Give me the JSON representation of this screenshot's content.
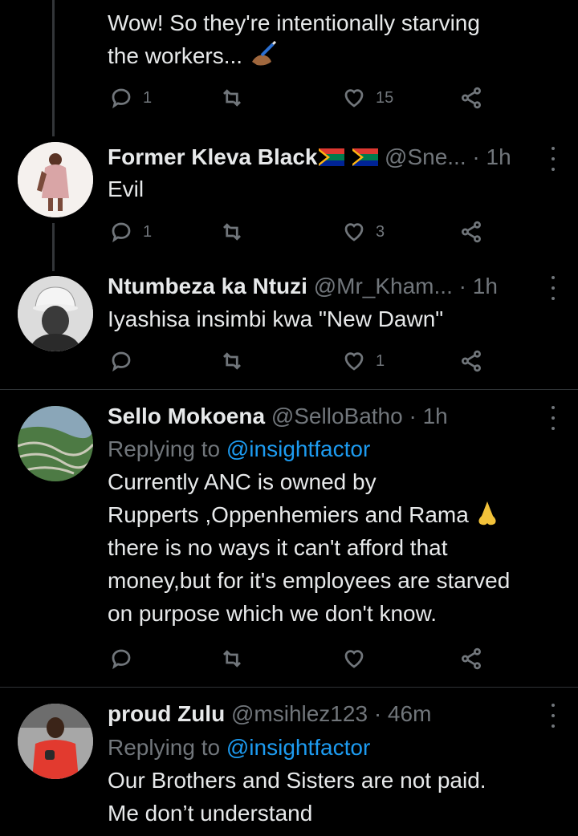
{
  "tweets": [
    {
      "text_lines": [
        "Wow! So they're intentionally starving",
        "the workers..."
      ],
      "replies": "1",
      "retweets": "",
      "likes": "15"
    },
    {
      "name": "Former Kleva Black",
      "handle": "@Sne...",
      "dot": "·",
      "time": "1h",
      "text": "Evil",
      "replies": "1",
      "retweets": "",
      "likes": "3"
    },
    {
      "name": "Ntumbeza ka Ntuzi",
      "handle": "@Mr_Kham...",
      "dot": "·",
      "time": "1h",
      "text": "Iyashisa insimbi kwa \"New Dawn\"",
      "replies": "",
      "retweets": "",
      "likes": "1"
    },
    {
      "name": "Sello Mokoena",
      "handle": "@SelloBatho",
      "dot": "·",
      "time": "1h",
      "replying_prefix": "Replying to",
      "replying_handle": "@insightfactor",
      "text_lines": [
        "Currently ANC is owned by",
        "Rupperts ,Oppenhemiers and Rama",
        "there is no ways it can't afford that",
        "money,but for it's employees are starved",
        "on purpose which we don't know."
      ],
      "replies": "",
      "retweets": "",
      "likes": ""
    },
    {
      "name": "proud Zulu",
      "handle": "@msihlez123",
      "dot": "·",
      "time": "46m",
      "replying_prefix": "Replying to",
      "replying_handle": "@insightfactor",
      "text_lines": [
        "Our Brothers and Sisters are not paid.",
        "Me don’t understand"
      ]
    }
  ],
  "icons": {
    "reply": "reply-icon",
    "retweet": "retweet-icon",
    "like": "heart-icon",
    "share": "share-icon",
    "more": "more-icon"
  },
  "colors": {
    "background": "#000000",
    "text": "#e7e9ea",
    "secondary": "#71767b",
    "link": "#1d9bf0",
    "divider": "#2f3336"
  }
}
